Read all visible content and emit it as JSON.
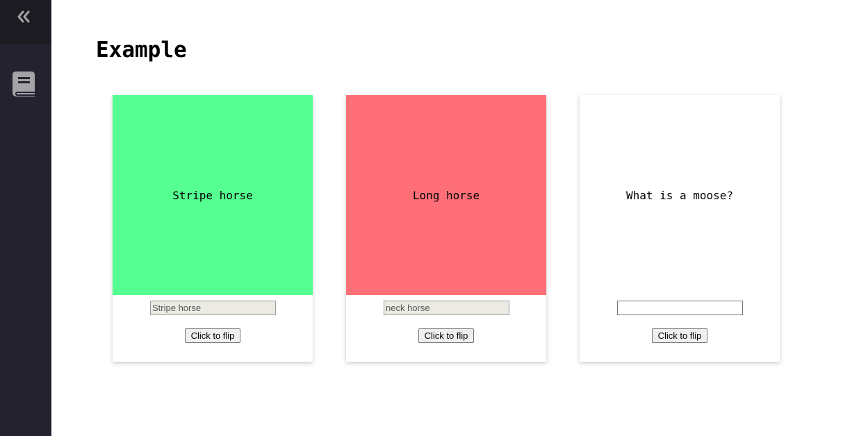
{
  "sidebar": {
    "collapse_icon": "chevron-double-left-icon",
    "nav_icon": "book-icon",
    "colors": {
      "background": "#24222f",
      "header_background": "#1c1b22",
      "icon": "#a3a3a8"
    }
  },
  "page": {
    "title": "Example"
  },
  "cards": [
    {
      "text": "Stripe horse",
      "input_value": "Stripe horse",
      "input_state": "disabled",
      "button_label": "Click to flip",
      "face_color": "#56ff91"
    },
    {
      "text": "Long horse",
      "input_value": "neck horse",
      "input_state": "disabled",
      "button_label": "Click to flip",
      "face_color": "#ff6f77"
    },
    {
      "text": "What is a moose?",
      "input_value": "",
      "input_state": "enabled",
      "button_label": "Click to flip",
      "face_color": "#ffffff"
    }
  ]
}
